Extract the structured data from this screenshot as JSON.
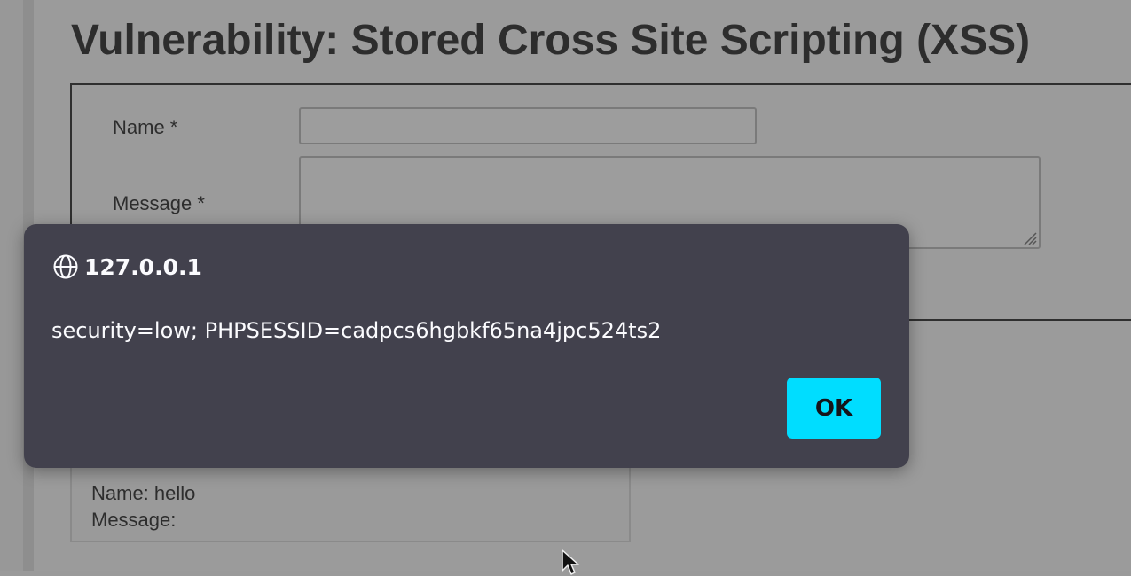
{
  "page": {
    "title": "Vulnerability: Stored Cross Site Scripting (XSS)"
  },
  "form": {
    "name_label": "Name *",
    "message_label": "Message *",
    "name_value": "",
    "message_value": ""
  },
  "entry": {
    "name_line": "Name: hello",
    "message_line": "Message:"
  },
  "dialog": {
    "origin": "127.0.0.1",
    "message": "security=low; PHPSESSID=cadpcs6hgbkf65na4jpc524ts2",
    "ok_label": "OK",
    "icon": "globe-icon",
    "ok_color": "#00ddff",
    "background_color": "#42414d"
  }
}
